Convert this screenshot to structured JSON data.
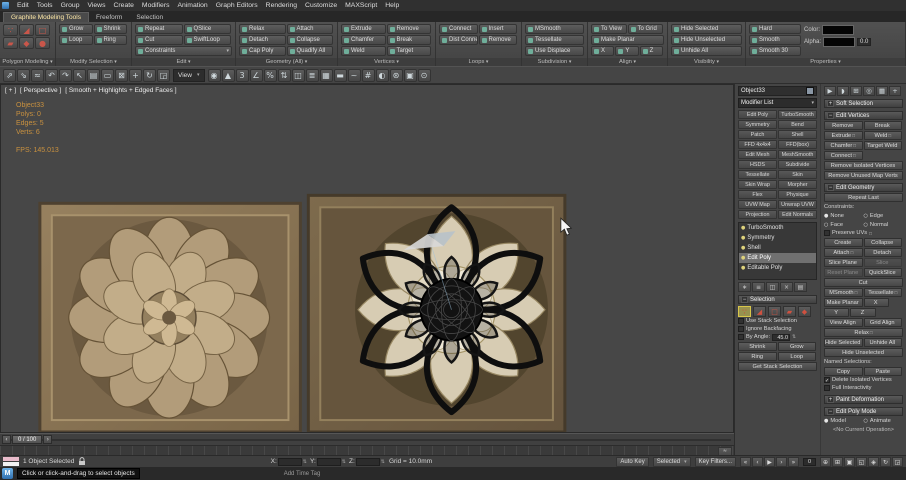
{
  "colors": {
    "accent": "#ffe9a8",
    "viewport_bg": "#474747",
    "stats_text": "#c9913f",
    "stone_dark": "#7a6648",
    "stone_light": "#d7ccb3",
    "wireframe": "#0e0e0e"
  },
  "menubar": {
    "items": [
      "Edit",
      "Tools",
      "Group",
      "Views",
      "Create",
      "Modifiers",
      "Animation",
      "Graph Editors",
      "Rendering",
      "Customize",
      "MAXScript",
      "Help"
    ]
  },
  "ribbon_tabs": [
    {
      "label": "Graphite Modeling Tools",
      "cls": "active"
    },
    {
      "label": "Freeform",
      "cls": ""
    },
    {
      "label": "Selection",
      "cls": ""
    }
  ],
  "ribbon": {
    "pm": {
      "title": "Polygon Modeling",
      "items": [
        {
          "g": "∵",
          "n": "vertex-mode-icon"
        },
        {
          "g": "◢",
          "n": "edge-mode-icon"
        },
        {
          "g": "□",
          "n": "border-mode-icon"
        },
        {
          "g": "▰",
          "n": "polygon-mode-icon"
        },
        {
          "g": "◆",
          "n": "element-mode-icon"
        },
        {
          "g": "●",
          "n": "object-mode-icon"
        }
      ]
    },
    "ms": {
      "title": "Modify Selection",
      "items": [
        {
          "l": "Grow",
          "c": "half"
        },
        {
          "l": "Shrink",
          "c": "half"
        },
        {
          "l": "Loop",
          "c": "half"
        },
        {
          "l": "Ring",
          "c": "half"
        }
      ]
    },
    "edit": {
      "title": "Edit",
      "items": [
        {
          "l": "Repeat",
          "c": "half"
        },
        {
          "l": "QSlice",
          "c": "half"
        },
        {
          "l": "Cut",
          "c": "half"
        },
        {
          "l": "SwiftLoop",
          "c": "half"
        },
        {
          "l": "Constraints",
          "c": "full dd"
        }
      ]
    },
    "geo": {
      "title": "Geometry (All)",
      "items": [
        {
          "l": "Relax",
          "c": "half"
        },
        {
          "l": "Attach",
          "c": "half"
        },
        {
          "l": "Detach",
          "c": "half"
        },
        {
          "l": "Collapse",
          "c": "half"
        },
        {
          "l": "Cap Poly",
          "c": "half"
        },
        {
          "l": "Quadify All",
          "c": "half"
        }
      ]
    },
    "vert": {
      "title": "Vertices",
      "items": [
        {
          "l": "Extrude",
          "c": "half"
        },
        {
          "l": "Remove",
          "c": "half"
        },
        {
          "l": "Chamfer",
          "c": "half"
        },
        {
          "l": "Break",
          "c": "half"
        },
        {
          "l": "Weld",
          "c": "half"
        },
        {
          "l": "Target",
          "c": "half"
        }
      ]
    },
    "loops": {
      "title": "Loops",
      "items": [
        {
          "l": "Connect",
          "c": "half"
        },
        {
          "l": "Insert",
          "c": "half"
        },
        {
          "l": "Dist Connect",
          "c": "half"
        },
        {
          "l": "Remove",
          "c": "half"
        }
      ]
    },
    "subd": {
      "title": "Subdivision",
      "items": [
        {
          "l": "MSmooth",
          "c": "full"
        },
        {
          "l": "Tessellate",
          "c": "full"
        },
        {
          "l": "Use Displace",
          "c": "full"
        }
      ]
    },
    "align": {
      "title": "Align",
      "items": [
        {
          "l": "To View",
          "c": "half"
        },
        {
          "l": "To Grid",
          "c": "half"
        },
        {
          "l": "Make Planar",
          "c": "full"
        },
        {
          "l": "X",
          "c": "third"
        },
        {
          "l": "Y",
          "c": "third"
        },
        {
          "l": "Z",
          "c": "third"
        }
      ]
    },
    "vis": {
      "title": "Visibility",
      "items": [
        {
          "l": "Hide Selected",
          "c": "full"
        },
        {
          "l": "Hide Unselected",
          "c": "full"
        },
        {
          "l": "Unhide All",
          "c": "full"
        }
      ]
    },
    "props": {
      "title": "Properties",
      "items": [
        {
          "l": "Hard",
          "c": "full"
        },
        {
          "l": "Smooth",
          "c": "full"
        },
        {
          "l": "Smooth 30",
          "c": "full"
        }
      ],
      "color_label": "Color:",
      "alpha_label": "Alpha:",
      "alpha_value": "0.0"
    }
  },
  "toolbar": {
    "left_icons": [
      {
        "n": "select-and-link-icon",
        "g": "⇗"
      },
      {
        "n": "unlink-selection-icon",
        "g": "⇘"
      },
      {
        "n": "bind-to-spacewarp-icon",
        "g": "≈"
      },
      {
        "n": "undo-icon",
        "g": "↶"
      },
      {
        "n": "redo-icon",
        "g": "↷"
      },
      {
        "n": "select-object-icon",
        "g": "↖"
      },
      {
        "n": "select-by-name-icon",
        "g": "▤"
      },
      {
        "n": "rectangular-region-icon",
        "g": "▭"
      },
      {
        "n": "window-crossing-icon",
        "g": "⊠"
      },
      {
        "n": "select-move-icon",
        "g": "+"
      },
      {
        "n": "select-rotate-icon",
        "g": "↻"
      },
      {
        "n": "select-scale-icon",
        "g": "◲"
      }
    ],
    "view_dropdown": "View",
    "right_icons": [
      {
        "n": "use-pivot-center-icon",
        "g": "◉"
      },
      {
        "n": "select-manipulate-icon",
        "g": "▲"
      },
      {
        "n": "snap-toggle-icon",
        "g": "3"
      },
      {
        "n": "angle-snap-icon",
        "g": "∠"
      },
      {
        "n": "percent-snap-icon",
        "g": "%"
      },
      {
        "n": "spinner-snap-icon",
        "g": "⇅"
      },
      {
        "n": "mirror-icon",
        "g": "◫"
      },
      {
        "n": "align-icon",
        "g": "≣"
      },
      {
        "n": "layer-manager-icon",
        "g": "▦"
      },
      {
        "n": "ribbon-toggle-icon",
        "g": "▬"
      },
      {
        "n": "curve-editor-icon",
        "g": "~"
      },
      {
        "n": "schematic-view-icon",
        "g": "#"
      },
      {
        "n": "material-editor-icon",
        "g": "◐"
      },
      {
        "n": "render-setup-icon",
        "g": "⊛"
      },
      {
        "n": "rendered-frame-icon",
        "g": "▣"
      },
      {
        "n": "render-production-icon",
        "g": "⊙"
      }
    ]
  },
  "viewport": {
    "labels": {
      "plus": "[ + ]",
      "view": "[ Perspective ]",
      "shading": "[ Smooth + Highlights + Edged Faces ]"
    },
    "stats": [
      {
        "t": "Object33",
        "c": ""
      },
      {
        "t": "Polys: 0",
        "c": ""
      },
      {
        "t": "Edges: 5",
        "c": ""
      },
      {
        "t": "Verts: 6",
        "c": ""
      },
      {
        "t": "FPS: 145.013",
        "c": "fps"
      }
    ]
  },
  "panelA": {
    "object_name": "Object33",
    "modifier_list": "Modifier List",
    "modifier_buttons": [
      {
        "l": "Edit Poly"
      },
      {
        "l": "TurboSmooth"
      },
      {
        "l": "Symmetry"
      },
      {
        "l": "Bend"
      },
      {
        "l": "Patch"
      },
      {
        "l": "Shell"
      },
      {
        "l": "FFD 4x4x4"
      },
      {
        "l": "FFD(box)"
      },
      {
        "l": "Edit Mesh"
      },
      {
        "l": "MeshSmooth"
      },
      {
        "l": "HSDS"
      },
      {
        "l": "Subdivide"
      },
      {
        "l": "Tessellate"
      },
      {
        "l": "Skin"
      },
      {
        "l": "Skin Wrap"
      },
      {
        "l": "Morpher"
      },
      {
        "l": "Flex"
      },
      {
        "l": "Physique"
      },
      {
        "l": "UVW Map"
      },
      {
        "l": "Unwrap UVW"
      },
      {
        "l": "Projection"
      },
      {
        "l": "Edit Normals"
      }
    ],
    "stack": [
      {
        "l": "TurboSmooth",
        "c": ""
      },
      {
        "l": "Symmetry",
        "c": ""
      },
      {
        "l": "Shell",
        "c": ""
      },
      {
        "l": "Edit Poly",
        "c": "active"
      },
      {
        "l": "Editable Poly",
        "c": ""
      }
    ],
    "stack_tools": [
      {
        "n": "pin-stack-icon",
        "g": "∗"
      },
      {
        "n": "show-end-result-icon",
        "g": "≡"
      },
      {
        "n": "make-unique-icon",
        "g": "◫"
      },
      {
        "n": "remove-modifier-icon",
        "g": "×"
      },
      {
        "n": "configure-modifier-sets-icon",
        "g": "▤"
      }
    ],
    "selection": {
      "title": "Selection",
      "subobj": [
        {
          "g": "∵",
          "c": "active",
          "n": "vertex-subobject-icon"
        },
        {
          "g": "◢",
          "c": "",
          "n": "edge-subobject-icon"
        },
        {
          "g": "□",
          "c": "",
          "n": "border-subobject-icon"
        },
        {
          "g": "▰",
          "c": "",
          "n": "polygon-subobject-icon"
        },
        {
          "g": "◆",
          "c": "",
          "n": "element-subobject-icon"
        }
      ],
      "checks": [
        {
          "l": "Use Stack Selection",
          "m": ""
        },
        {
          "l": "Ignore Backfacing",
          "m": ""
        }
      ],
      "by_angle": {
        "label": "By Angle:",
        "value": "45.0"
      },
      "buttons": [
        {
          "l": "Shrink",
          "c": "half"
        },
        {
          "l": "Grow",
          "c": "half"
        },
        {
          "l": "Ring",
          "c": "half"
        },
        {
          "l": "Loop",
          "c": "half"
        },
        {
          "l": "Get Stack Selection",
          "c": "full"
        }
      ]
    }
  },
  "panelB": {
    "tabs": [
      {
        "n": "create-tab-icon",
        "g": "▶"
      },
      {
        "n": "modify-tab-icon",
        "g": "◗"
      },
      {
        "n": "hierarchy-tab-icon",
        "g": "⊞"
      },
      {
        "n": "motion-tab-icon",
        "g": "◎"
      },
      {
        "n": "display-tab-icon",
        "g": "▦"
      },
      {
        "n": "utilities-tab-icon",
        "g": "+"
      }
    ],
    "soft_selection": {
      "title": "Soft Selection",
      "toggle": "+"
    },
    "edit_vertices": {
      "title": "Edit Vertices",
      "toggle": "−",
      "items": [
        {
          "l": "Remove",
          "c": "half"
        },
        {
          "l": "Break",
          "c": "half"
        },
        {
          "l": "Extrude",
          "c": "half",
          "b": "□"
        },
        {
          "l": "Weld",
          "c": "half",
          "b": "□"
        },
        {
          "l": "Chamfer",
          "c": "half",
          "b": "□"
        },
        {
          "l": "Target Weld",
          "c": "half"
        },
        {
          "l": "Connect",
          "c": "half",
          "b": "□"
        },
        {
          "l": "",
          "c": "half ghost"
        },
        {
          "l": "Remove Isolated Vertices",
          "c": "full"
        },
        {
          "l": "Remove Unused Map Verts",
          "c": "full"
        }
      ]
    },
    "edit_geometry": {
      "title": "Edit Geometry",
      "toggle": "−",
      "repeat_last": "Repeat Last",
      "constraints": {
        "label": "Constraints:",
        "options": [
          {
            "l": "None",
            "d": "●"
          },
          {
            "l": "Edge",
            "d": "○"
          },
          {
            "l": "Face",
            "d": "○"
          },
          {
            "l": "Normal",
            "d": "○"
          }
        ]
      },
      "preserve_uvs": {
        "l": "Preserve UVs",
        "b": "□"
      },
      "items": [
        {
          "l": "Create",
          "c": "half"
        },
        {
          "l": "Collapse",
          "c": "half"
        },
        {
          "l": "Attach",
          "c": "half",
          "b": "□"
        },
        {
          "l": "Detach",
          "c": "half"
        },
        {
          "l": "Slice Plane",
          "c": "half"
        },
        {
          "l": "Slice",
          "c": "half dis"
        },
        {
          "l": "Reset Plane",
          "c": "half dis"
        },
        {
          "l": "QuickSlice",
          "c": "half"
        },
        {
          "l": "Cut",
          "c": "full"
        },
        {
          "l": "MSmooth",
          "c": "half",
          "b": "□"
        },
        {
          "l": "Tessellate",
          "c": "half",
          "b": "□"
        },
        {
          "l": "Make Planar",
          "c": "half"
        },
        {
          "l": "X",
          "c": "third"
        },
        {
          "l": "Y",
          "c": "third"
        },
        {
          "l": "Z",
          "c": "third"
        },
        {
          "l": "View Align",
          "c": "half"
        },
        {
          "l": "Grid Align",
          "c": "half"
        },
        {
          "l": "Relax",
          "c": "full",
          "b": "□"
        },
        {
          "l": "Hide Selected",
          "c": "half"
        },
        {
          "l": "Unhide All",
          "c": "half"
        },
        {
          "l": "Hide Unselected",
          "c": "full"
        }
      ],
      "named_label": "Named Selections:",
      "named_items": [
        {
          "l": "Copy",
          "c": "half"
        },
        {
          "l": "Paste",
          "c": "half"
        }
      ],
      "checks": [
        {
          "l": "Delete Isolated Vertices",
          "m": "✓"
        },
        {
          "l": "Full Interactivity",
          "m": ""
        }
      ]
    },
    "paint_deformation": {
      "title": "Paint Deformation",
      "toggle": "+"
    },
    "edit_poly_mode": {
      "title": "Edit Poly Mode",
      "model": {
        "l": "Model",
        "d": "●"
      },
      "animate": {
        "l": "Animate",
        "d": "○"
      },
      "status": "<No Current Operation>"
    }
  },
  "timeslider": {
    "value": "0 / 100",
    "left": "‹",
    "right": "›"
  },
  "statusbar": {
    "status": "1 Object Selected",
    "coords": [
      {
        "label": "X:",
        "value": ""
      },
      {
        "label": "Y:",
        "value": ""
      },
      {
        "label": "Z:",
        "value": ""
      }
    ],
    "grid": "Grid = 10.0mm",
    "auto_key": "Auto Key",
    "selection_set": "Selected",
    "key_filters": "Key Filters...",
    "transport": [
      {
        "n": "go-to-start-icon",
        "g": "«"
      },
      {
        "n": "previous-frame-icon",
        "g": "‹"
      },
      {
        "n": "play-icon",
        "g": "▶"
      },
      {
        "n": "next-frame-icon",
        "g": "›"
      },
      {
        "n": "go-to-end-icon",
        "g": "»"
      }
    ],
    "frame": "0",
    "nav": [
      {
        "n": "zoom-icon",
        "g": "⊕"
      },
      {
        "n": "zoom-all-icon",
        "g": "⊞"
      },
      {
        "n": "zoom-extents-icon",
        "g": "▣"
      },
      {
        "n": "zoom-region-icon",
        "g": "◱"
      },
      {
        "n": "pan-icon",
        "g": "◈"
      },
      {
        "n": "orbit-icon",
        "g": "↻"
      },
      {
        "n": "maximize-viewport-icon",
        "g": "◲"
      }
    ]
  },
  "prompt": {
    "badge": "M",
    "text": "Click or click-and-drag to select objects",
    "time_tag": "Add Time Tag"
  }
}
